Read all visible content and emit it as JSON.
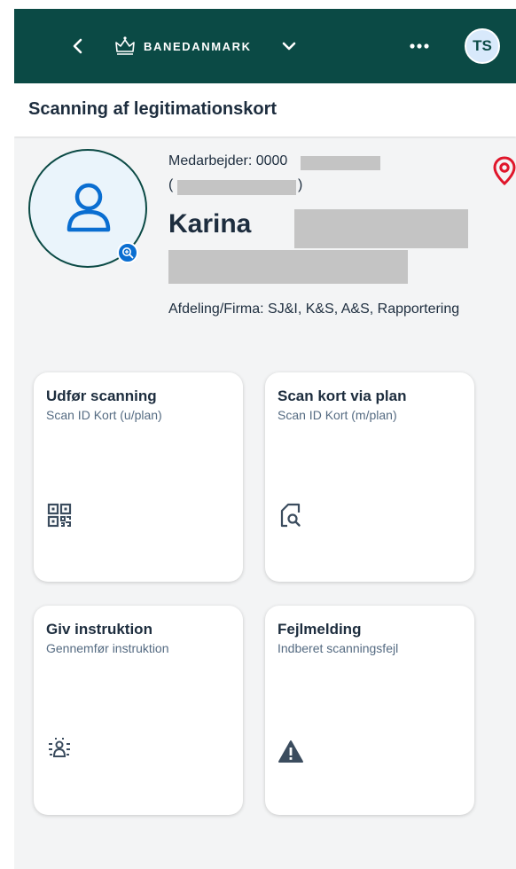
{
  "header": {
    "brand": "BANEDANMARK",
    "avatar_initials": "TS",
    "icons": [
      "back-icon",
      "crown-logo",
      "chevron-down-icon",
      "more-icon"
    ]
  },
  "page": {
    "title": "Scanning af legitimationskort"
  },
  "employee": {
    "id_label": "Medarbejder: 0000",
    "paren_open": "(",
    "paren_close": ")",
    "first_name": "Karina",
    "department": "Afdeling/Firma: SJ&I, K&S, A&S, Rapportering"
  },
  "tiles": [
    {
      "title": "Udfør scanning",
      "subtitle": "Scan ID Kort (u/plan)",
      "icon": "qr-code-icon"
    },
    {
      "title": "Scan kort via plan",
      "subtitle": "Scan ID Kort (m/plan)",
      "icon": "document-search-icon"
    },
    {
      "title": "Giv instruktion",
      "subtitle": "Gennemfør instruktion",
      "icon": "group-person-icon"
    },
    {
      "title": "Fejlmelding",
      "subtitle": "Indberet scanningsfejl",
      "icon": "warning-icon"
    }
  ],
  "colors": {
    "header_bg": "#0b4a45",
    "accent_blue": "#0a6ed1",
    "pin_red": "#e0162b",
    "page_bg": "#f3f4f5"
  }
}
